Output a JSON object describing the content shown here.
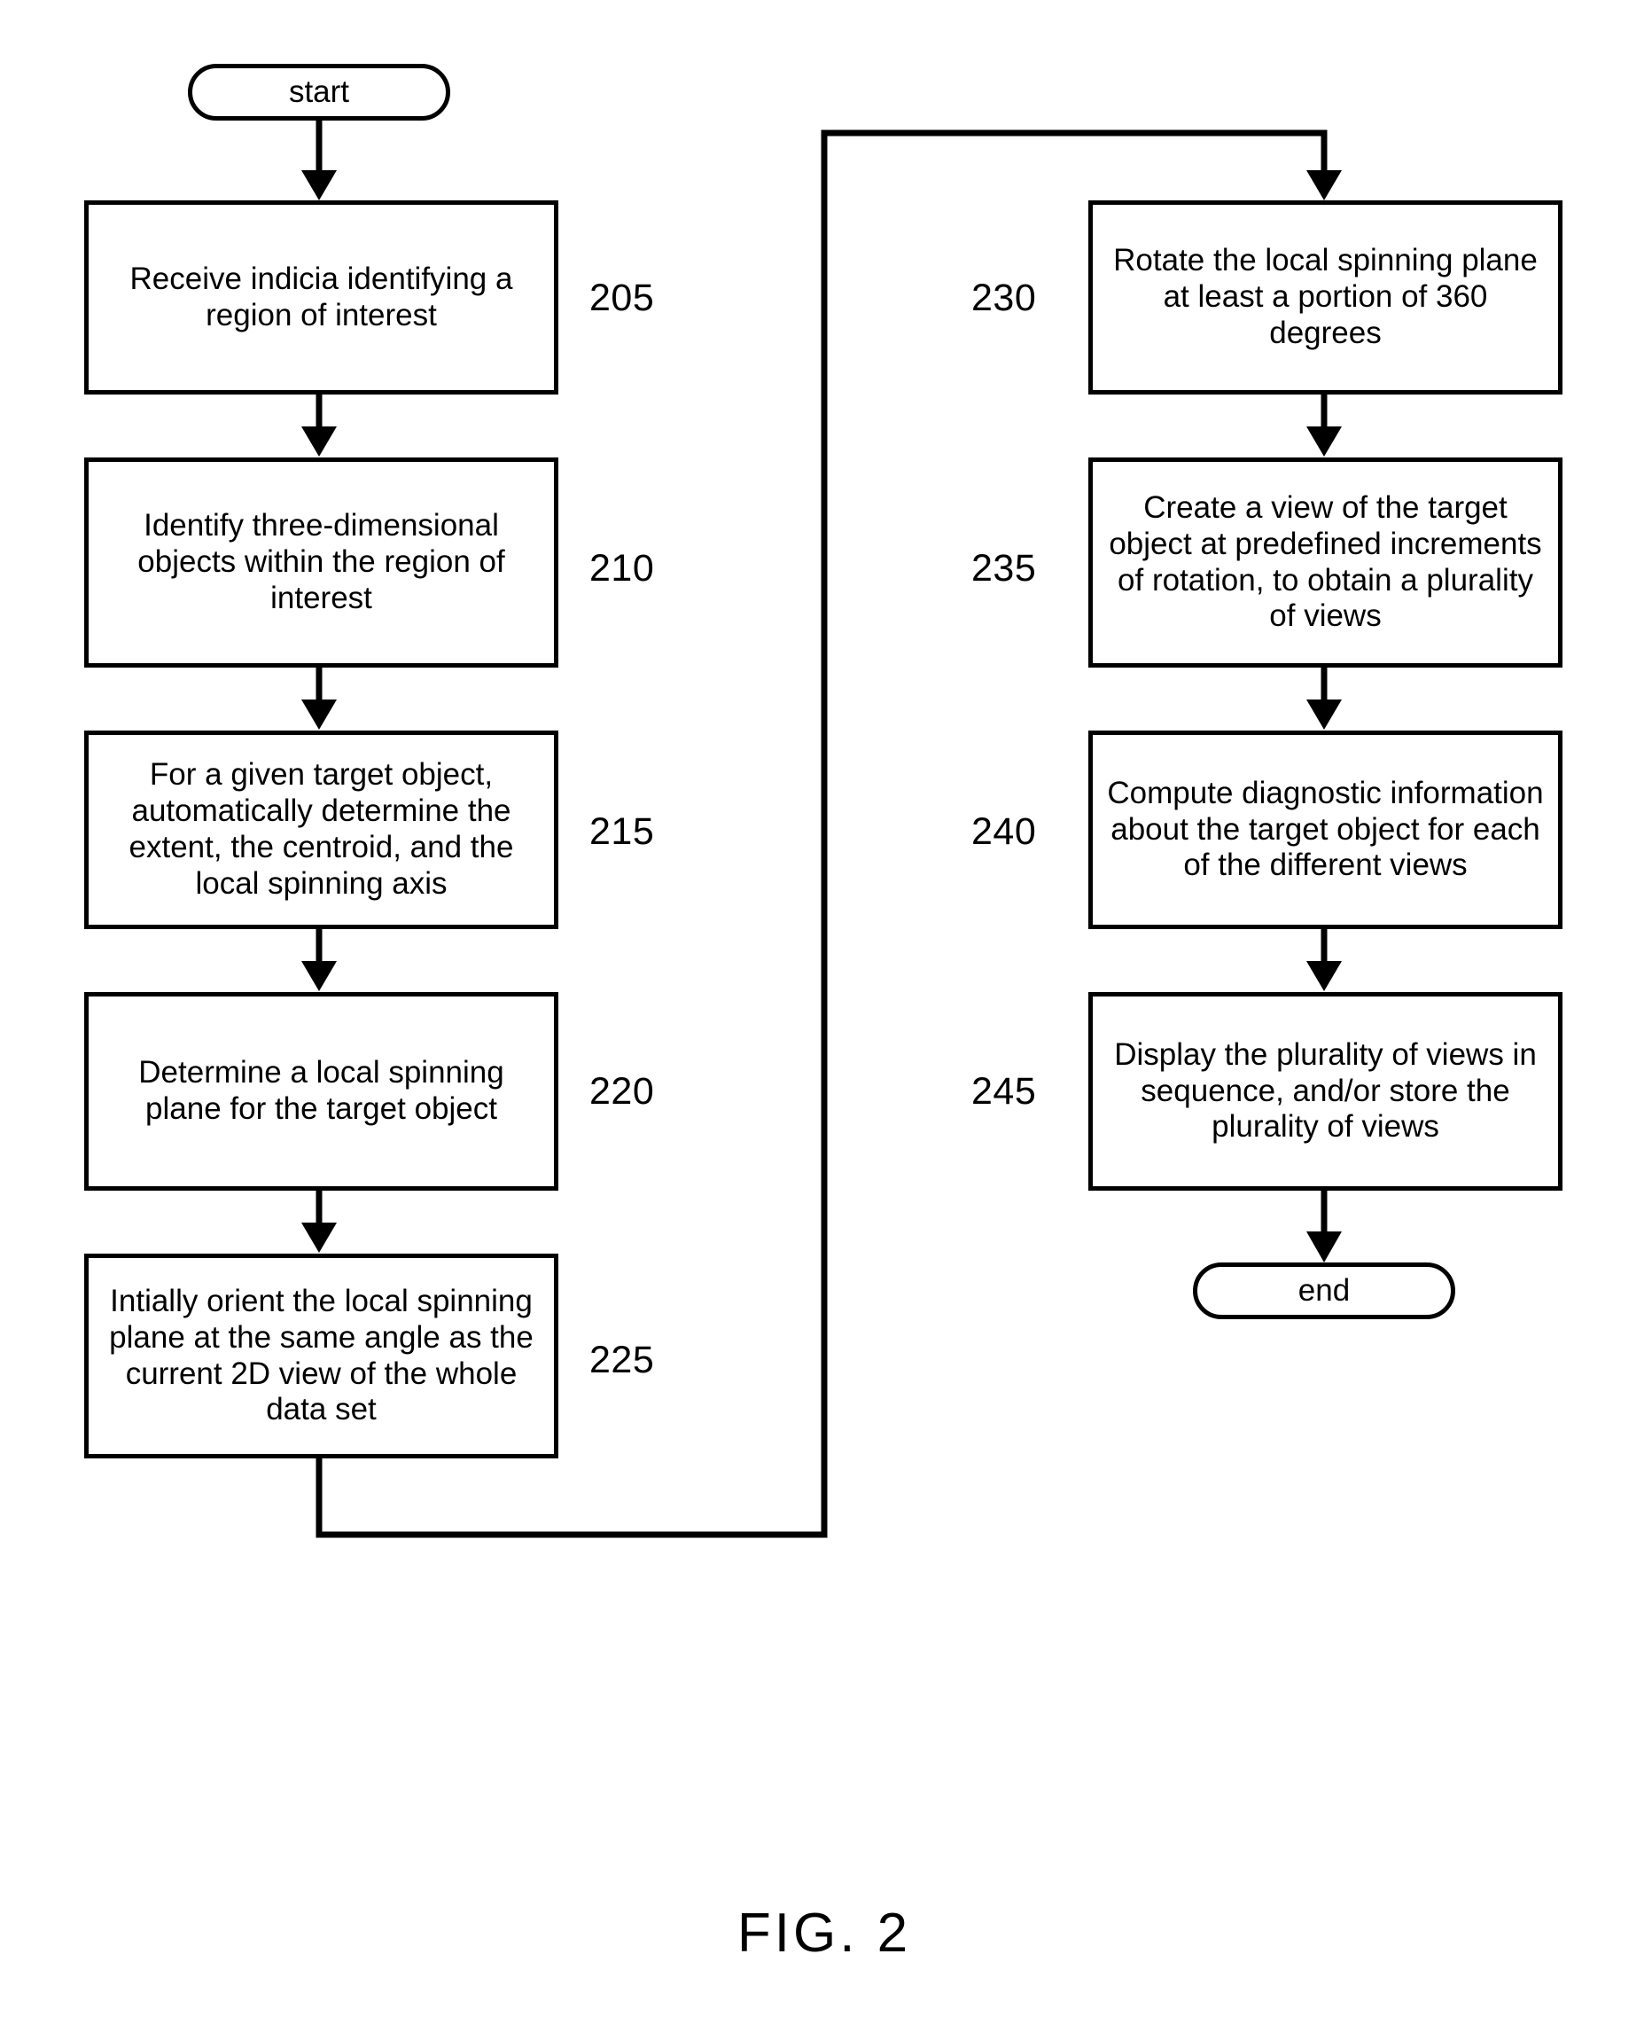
{
  "figure": {
    "label": "FIG. 2"
  },
  "terminals": {
    "start": "start",
    "end": "end"
  },
  "left_column": [
    {
      "ref": "205",
      "text": "Receive indicia identifying a region of interest"
    },
    {
      "ref": "210",
      "text": "Identify three-dimensional objects within the region of interest"
    },
    {
      "ref": "215",
      "text": "For a given target object, automatically determine the extent, the centroid, and the local spinning axis"
    },
    {
      "ref": "220",
      "text": "Determine a local spinning plane for the target object"
    },
    {
      "ref": "225",
      "text": "Intially orient the local spinning plane at the same angle as the current 2D view of the whole data set"
    }
  ],
  "right_column": [
    {
      "ref": "230",
      "text": "Rotate the local spinning plane at least a portion of 360 degrees"
    },
    {
      "ref": "235",
      "text": "Create a view of the target object at predefined increments of rotation, to obtain a plurality of views"
    },
    {
      "ref": "240",
      "text": "Compute diagnostic information about the target object for each of the different views"
    },
    {
      "ref": "245",
      "text": "Display the plurality of views in sequence, and/or store the plurality of views"
    }
  ],
  "colors": {
    "stroke": "#000000",
    "fill": "#ffffff"
  }
}
